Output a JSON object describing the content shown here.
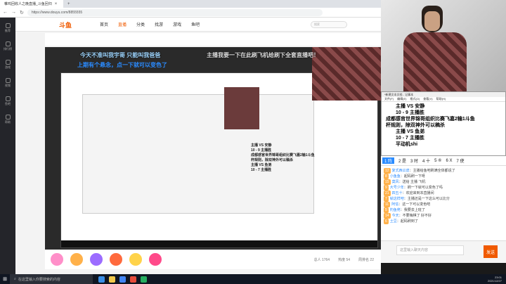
{
  "browser": {
    "tab_title": "雏鸡回收人之晚直播_斗鱼回归",
    "url": "https://www.douyu.com/8855555"
  },
  "sidebar": {
    "items": [
      {
        "label": "推荐"
      },
      {
        "label": "排行榜"
      },
      {
        "label": "游戏"
      },
      {
        "label": "视频"
      },
      {
        "label": "鱼吧"
      },
      {
        "label": "帮助"
      }
    ]
  },
  "site": {
    "logo": "斗鱼",
    "nav": [
      "首页",
      "直播",
      "分类",
      "找游",
      "游戏",
      "鱼吧"
    ],
    "search_placeholder": "搜索"
  },
  "stream": {
    "overlay_1": "今天不准叫我宇哥 只能叫我爸爸",
    "overlay_2": "主播我要一下在此刷飞机给刷下全套直播吧！",
    "overlay_3": "上期有个悬念，点一下就可以变色了",
    "notes": [
      "主播 VS 安静",
      "10 - 9 主播胜",
      "成都感官世界锦哥组织比赛飞嘉2输1斗鱼",
      "杯规则，除双神外可以稿杀",
      "主播 VS 鱼弟",
      "10 - 7 主播胜"
    ]
  },
  "giftbar": {
    "meta": [
      "总人 1764",
      "热度 54",
      "周排名 22"
    ]
  },
  "notepad": {
    "title": "*新建文本文档 - 记事本",
    "menu": [
      "文件(F)",
      "编辑(E)",
      "格式(O)",
      "查看(V)",
      "帮助(H)"
    ],
    "lines": [
      {
        "text": "主播 VS 安静",
        "indent": true
      },
      {
        "text": "10 - 9 主播胜",
        "indent": true
      },
      {
        "text": "成都感官世界锦哥组织比赛飞嘉2输1斗鱼",
        "indent": false
      },
      {
        "text": "杯规则，除双神外可以稿杀",
        "indent": false
      },
      {
        "text": "主播 VS 鱼弟",
        "indent": true
      },
      {
        "text": "10 - 7 主播胜",
        "indent": true
      },
      {
        "text": "平动机shi",
        "indent": true
      }
    ]
  },
  "rank": {
    "items": [
      "1 阵",
      "2 是",
      "3 时",
      "4 十",
      "5 ⑥",
      "6 X",
      "7 使"
    ]
  },
  "chat": {
    "messages": [
      {
        "user": "复式西瓜皮",
        "text": "主播给鱼吧刷满全体都说了"
      },
      {
        "user": "小鱼鱼",
        "text": "起码刷一下呀"
      },
      {
        "user": "莫风",
        "text": "送给 主播 飞机"
      },
      {
        "user": "大号少年",
        "text": "刷一下就可以变色了吗"
      },
      {
        "user": "四五十",
        "text": "欢迎来到本直播间"
      },
      {
        "user": "就这样吧",
        "text": "主播还是一下这么可以比分"
      },
      {
        "user": "阿信",
        "text": "这一下可以变色吧"
      },
      {
        "user": "钓鱼佬",
        "text": "我要去上班了"
      },
      {
        "user": "今天",
        "text": "不要悔棋了 好不好"
      },
      {
        "user": "土豆",
        "text": "起码刷到了"
      }
    ]
  },
  "chatinput": {
    "placeholder": "这里输入聊天内容",
    "send_label": "发送"
  },
  "taskbar": {
    "search_placeholder": "在这里输入你要搜索的内容",
    "time": "23:01",
    "date": "2021/12/27"
  }
}
